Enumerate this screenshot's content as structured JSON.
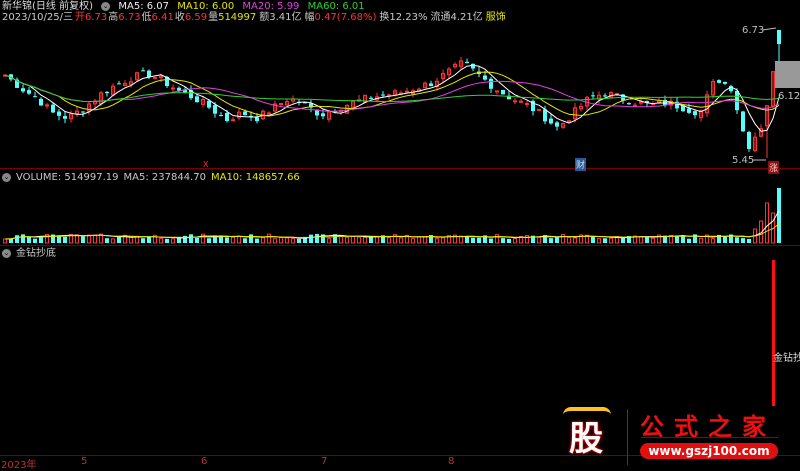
{
  "header": {
    "title": "新华锦(日线 前复权)",
    "ma5": "MA5: 6.07",
    "ma10": "MA10: 6.00",
    "ma20": "MA20: 5.99",
    "ma60": "MA60: 6.01",
    "date": "2023/10/25/三",
    "open_label": "开",
    "open": "6.73",
    "high_label": "高",
    "high": "6.73",
    "low_label": "低",
    "low": "6.41",
    "close_label": "收",
    "close": "6.59",
    "vol_label": "量",
    "vol": "514997",
    "amount": "额3.41亿",
    "change_label": "幅",
    "change": "0.47(7.68%)",
    "turnover": "换12.23%",
    "float": "流通4.21亿",
    "sector": "服饰"
  },
  "price_panel": {
    "high_marker": "6.73",
    "low_marker": "5.45",
    "current_price": "6.12",
    "badge_cai": "财",
    "badge_zhang": "涨",
    "badge_x": "X"
  },
  "volume_panel": {
    "volume": "VOLUME: 514997.19",
    "ma5": "MA5: 237844.70",
    "ma10": "MA10: 148657.66"
  },
  "indicator_panel": {
    "title": "金钻抄底",
    "signal_label": "金钻抄"
  },
  "x_axis": [
    "2023年",
    "5",
    "6",
    "7",
    "8"
  ],
  "watermark": {
    "brand": "股",
    "name": "公式之家",
    "url": "www.gszj100.com"
  },
  "colors": {
    "up": "#ff3232",
    "down": "#54ffff",
    "ma5": "#ffffff",
    "ma10": "#e6e600",
    "ma20": "#e040e0",
    "ma60": "#30d030",
    "grid": "#7a0000"
  },
  "chart_data": {
    "type": "candlestick",
    "key_closes": [
      6.28,
      6.15,
      6.05,
      5.9,
      5.85,
      5.95,
      6.08,
      6.18,
      6.25,
      6.3,
      6.22,
      6.12,
      6.05,
      5.95,
      5.83,
      5.9,
      5.85,
      5.95,
      6.05,
      5.98,
      5.88,
      5.95,
      6.0,
      6.05,
      6.08,
      6.1,
      6.15,
      6.2,
      6.3,
      6.4,
      6.28,
      6.15,
      6.05,
      5.98,
      5.88,
      5.75,
      5.9,
      6.05,
      6.1,
      6.05,
      6.0,
      5.98,
      6.0,
      5.95,
      5.9,
      6.25,
      6.15,
      5.55,
      5.8,
      6.59
    ],
    "price_range": [
      5.45,
      6.73
    ]
  }
}
